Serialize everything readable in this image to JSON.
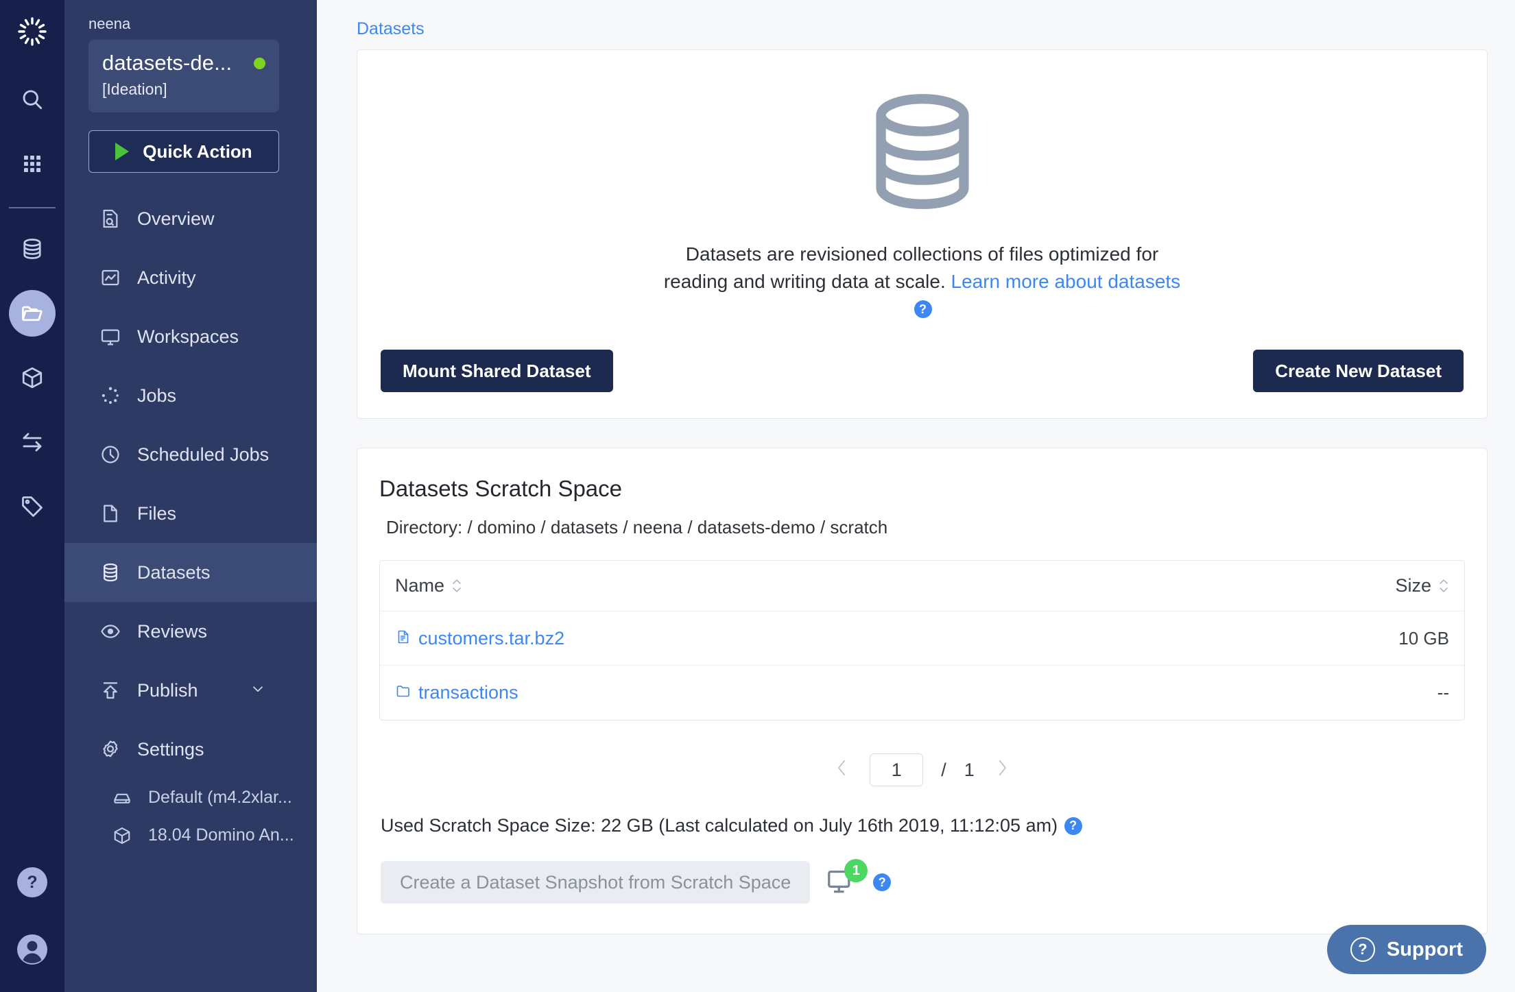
{
  "rail": {
    "logo_icon": "domino-logo-icon",
    "items": [
      {
        "icon": "search-icon",
        "name": "search"
      },
      {
        "icon": "grid-apps-icon",
        "name": "apps"
      },
      {
        "icon": "database-icon",
        "name": "data"
      },
      {
        "icon": "folder-open-icon",
        "name": "projects",
        "active": true
      },
      {
        "icon": "cube-icon",
        "name": "environments"
      },
      {
        "icon": "transfer-arrows-icon",
        "name": "transfers"
      },
      {
        "icon": "tag-icon",
        "name": "tags"
      }
    ],
    "help_label": "?",
    "avatar_icon": "user-avatar-icon"
  },
  "sidebar": {
    "owner": "neena",
    "project_name": "datasets-de...",
    "project_stage": "[Ideation]",
    "status_color": "#7ed321",
    "quick_action_label": "Quick Action",
    "items": [
      {
        "label": "Overview",
        "icon": "overview-icon"
      },
      {
        "label": "Activity",
        "icon": "activity-chart-icon"
      },
      {
        "label": "Workspaces",
        "icon": "monitor-icon"
      },
      {
        "label": "Jobs",
        "icon": "spinner-dots-icon"
      },
      {
        "label": "Scheduled Jobs",
        "icon": "clock-icon"
      },
      {
        "label": "Files",
        "icon": "file-icon"
      },
      {
        "label": "Datasets",
        "icon": "database-icon",
        "active": true
      },
      {
        "label": "Reviews",
        "icon": "eye-icon"
      },
      {
        "label": "Publish",
        "icon": "upload-icon",
        "expandable": true
      },
      {
        "label": "Settings",
        "icon": "gear-icon"
      }
    ],
    "sub_items": [
      {
        "label": "Default (m4.2xlar...",
        "icon": "hardware-tier-icon"
      },
      {
        "label": "18.04 Domino An...",
        "icon": "cube-icon"
      }
    ]
  },
  "main": {
    "breadcrumb": "Datasets",
    "hero": {
      "icon": "database-large-icon",
      "text_before": "Datasets are revisioned collections of files optimized for reading and writing data at scale. ",
      "link_text": "Learn more about datasets",
      "help_label": "?",
      "mount_button": "Mount Shared Dataset",
      "create_button": "Create New Dataset"
    },
    "scratch": {
      "title": "Datasets Scratch Space",
      "directory": "Directory: / domino / datasets / neena / datasets-demo / scratch",
      "columns": [
        "Name",
        "Size"
      ],
      "rows": [
        {
          "name": "customers.tar.bz2",
          "size": "10 GB",
          "icon": "file-icon"
        },
        {
          "name": "transactions",
          "size": "--",
          "icon": "folder-icon"
        }
      ],
      "pagination": {
        "current": "1",
        "separator": "/",
        "total": "1",
        "prev_icon": "chevron-left-icon",
        "next_icon": "chevron-right-icon"
      },
      "used_space": "Used Scratch Space Size: 22 GB (Last calculated on July 16th 2019, 11:12:05 am)",
      "used_help_label": "?",
      "snapshot_button": "Create a Dataset Snapshot from Scratch Space",
      "snapshot_badge": "1",
      "snapshot_help_label": "?"
    },
    "support_label": "Support",
    "support_icon_label": "?"
  }
}
